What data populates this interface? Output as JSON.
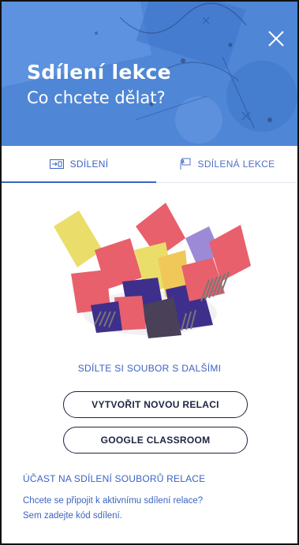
{
  "header": {
    "title": "Sdílení lekce",
    "subtitle": "Co chcete dělat?",
    "background_color": "#4f86d6"
  },
  "tabs": [
    {
      "label": "SDÍLENÍ",
      "icon": "share-screen-icon",
      "active": true
    },
    {
      "label": "SDÍLENÁ LEKCE",
      "icon": "joined-lesson-icon",
      "active": false
    }
  ],
  "main": {
    "share_caption": "SDÍLTE SI SOUBOR S DALŠÍMI",
    "create_session_label": "VYTVOŘIT NOVOU RELACI",
    "google_classroom_label": "GOOGLE CLASSROOM"
  },
  "join": {
    "title": "ÚČAST NA SDÍLENÍ SOUBORŮ RELACE",
    "line1": "Chcete se připojit k aktivnímu sdílení relace?",
    "line2": "Sem zadejte kód sdílení."
  },
  "colors": {
    "accent": "#3b63c4",
    "button_border": "#1d2440",
    "paper_red": "#e8606b",
    "paper_yellow": "#ebdd6a",
    "paper_purple": "#3f2f8c",
    "paper_lilac": "#9c8ad6"
  }
}
